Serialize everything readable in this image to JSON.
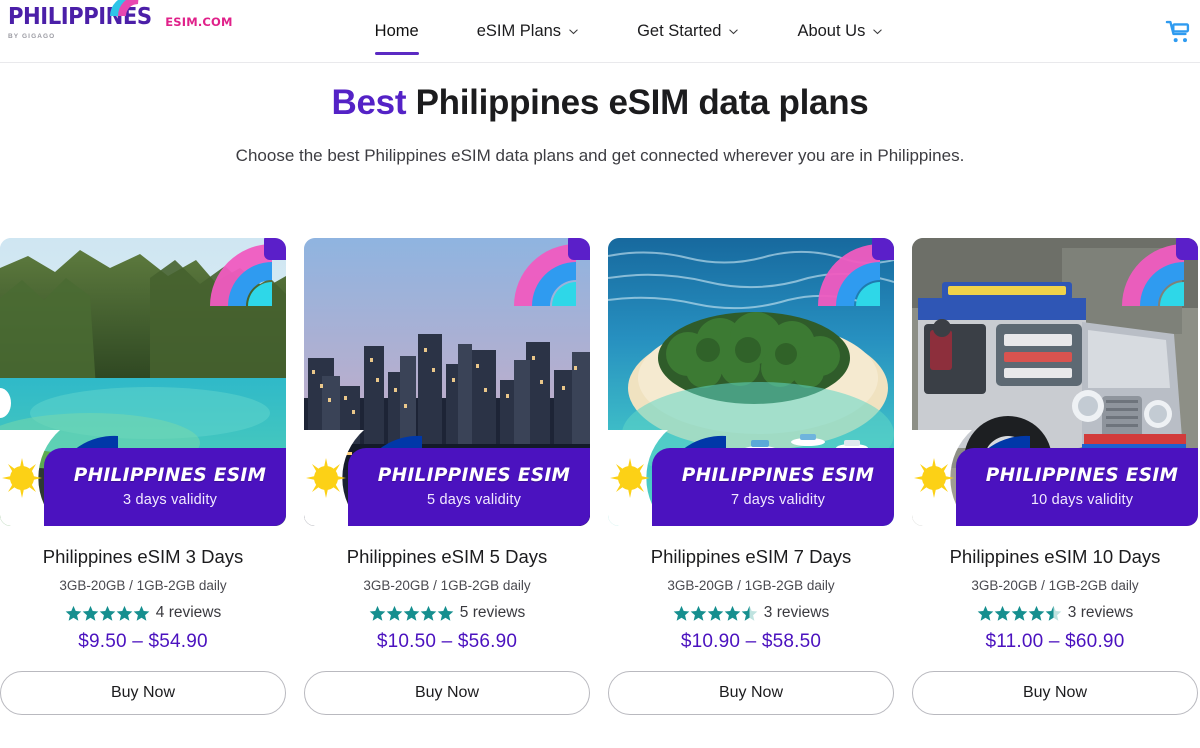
{
  "brand": {
    "logo_main": "PHILIPPINES",
    "logo_sub": "ESIM.COM",
    "logo_byline": "BY GIGAGO",
    "logo_main_color": "#4b1fa8",
    "logo_sub_color": "#e0218a"
  },
  "nav": {
    "items": [
      {
        "label": "Home",
        "has_caret": false,
        "active": true
      },
      {
        "label": "eSIM Plans",
        "has_caret": true,
        "active": false
      },
      {
        "label": "Get Started",
        "has_caret": true,
        "active": false
      },
      {
        "label": "About Us",
        "has_caret": true,
        "active": false
      }
    ],
    "active_underline_color": "#5b2ac3",
    "cart_icon": "shopping-cart-icon",
    "cart_color": "#2f9bf0"
  },
  "hero": {
    "title_accent": "Best",
    "title_rest": " Philippines eSIM data plans",
    "accent_color": "#5422c6",
    "subtitle": "Choose the best Philippines eSIM data plans and get connected wherever you are in Philippines."
  },
  "cards": [
    {
      "title": "Philippines eSIM 3 Days",
      "data_line": "3GB-20GB / 1GB-2GB daily",
      "rating": 5,
      "reviews": "4 reviews",
      "price": "$9.50 – $54.90",
      "banner_title": "PHILIPPINES ESIM",
      "banner_sub": "3 days validity",
      "buy_label": "Buy Now",
      "image_alt": "el-nido-limestone-cliffs-lagoon"
    },
    {
      "title": "Philippines eSIM 5 Days",
      "data_line": "3GB-20GB / 1GB-2GB daily",
      "rating": 5,
      "reviews": "5 reviews",
      "price": "$10.50 – $56.90",
      "banner_title": "PHILIPPINES ESIM",
      "banner_sub": "5 days validity",
      "buy_label": "Buy Now",
      "image_alt": "manila-makati-skyline-at-dusk"
    },
    {
      "title": "Philippines eSIM 7 Days",
      "data_line": "3GB-20GB / 1GB-2GB daily",
      "rating": 4.5,
      "reviews": "3 reviews",
      "price": "$10.90 – $58.50",
      "banner_title": "PHILIPPINES ESIM",
      "banner_sub": "7 days validity",
      "buy_label": "Buy Now",
      "image_alt": "tropical-island-white-beach-outrigger-boats"
    },
    {
      "title": "Philippines eSIM 10 Days",
      "data_line": "3GB-20GB / 1GB-2GB daily",
      "rating": 4.5,
      "reviews": "3 reviews",
      "price": "$11.00 – $60.90",
      "banner_title": "PHILIPPINES ESIM",
      "banner_sub": "10 days validity",
      "buy_label": "Buy Now",
      "image_alt": "philippine-jeepney-chrome-front"
    }
  ],
  "theme": {
    "banner_purple": "#4b12bf",
    "price_purple": "#4b12bf",
    "star_teal": "#168f8f",
    "flag_blue": "#0038a8",
    "flag_red": "#ce1126",
    "flag_sun": "#fcd116"
  }
}
